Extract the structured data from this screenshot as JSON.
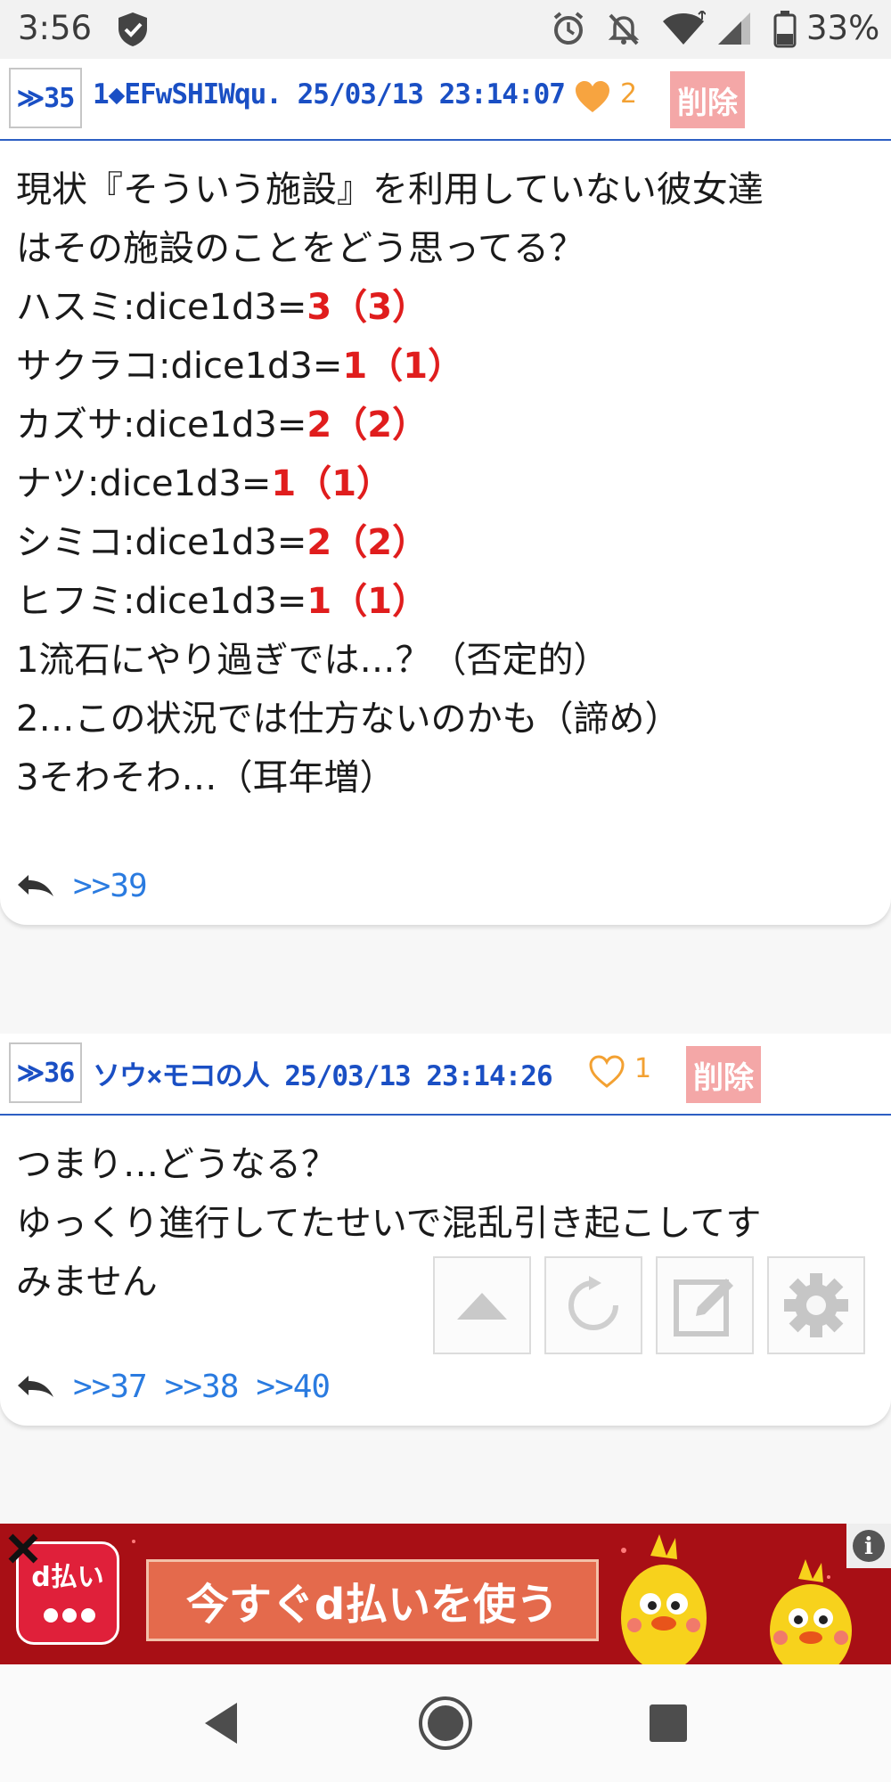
{
  "status_bar": {
    "time": "3:56",
    "battery": "33%"
  },
  "posts": [
    {
      "number": "≫35",
      "author": "1◆EFwSHIWqu.",
      "timestamp": "25/03/13 23:14:07",
      "likes": "2",
      "liked": true,
      "delete_label": "削除",
      "lines": [
        {
          "text": "現状『そういう施設』を利用していない彼女達"
        },
        {
          "text": "はその施設のことをどう思ってる？"
        },
        {
          "text": "ハスミ:dice1d3=",
          "value": "3",
          "paren": "（3）"
        },
        {
          "text": "サクラコ:dice1d3=",
          "value": "1",
          "paren": "（1）"
        },
        {
          "text": "カズサ:dice1d3=",
          "value": "2",
          "paren": "（2）"
        },
        {
          "text": "ナツ:dice1d3=",
          "value": "1",
          "paren": "（1）"
        },
        {
          "text": "シミコ:dice1d3=",
          "value": "2",
          "paren": "（2）"
        },
        {
          "text": "ヒフミ:dice1d3=",
          "value": "1",
          "paren": "（1）"
        },
        {
          "text": "1流石にやり過ぎでは…？（否定的）"
        },
        {
          "text": "2…この状況では仕方ないのかも（諦め）"
        },
        {
          "text": "3そわそわ…（耳年増）"
        }
      ],
      "replies": [
        ">>39"
      ]
    },
    {
      "number": "≫36",
      "author": "ソウ×モコの人",
      "timestamp": "25/03/13 23:14:26",
      "likes": "1",
      "liked": false,
      "delete_label": "削除",
      "lines": [
        {
          "text": "つまり…どうなる？"
        },
        {
          "text": "ゆっくり進行してたせいで混乱引き起こしてす"
        },
        {
          "text": "みません"
        }
      ],
      "replies": [
        ">>37",
        ">>38",
        ">>40"
      ]
    }
  ],
  "toolbar": {
    "icons": [
      "scroll-top-icon",
      "refresh-icon",
      "compose-icon",
      "settings-icon"
    ]
  },
  "ad": {
    "logo_text": "d払い",
    "cta": "今すぐd払いを使う",
    "info": "i"
  },
  "colors": {
    "accent_blue": "#1a4fc4",
    "link_blue": "#2a7be0",
    "dice_red": "#e01d1d",
    "like_orange": "#f3a132",
    "delete_pink": "#f4a7a7",
    "ad_red": "#a80f15"
  }
}
